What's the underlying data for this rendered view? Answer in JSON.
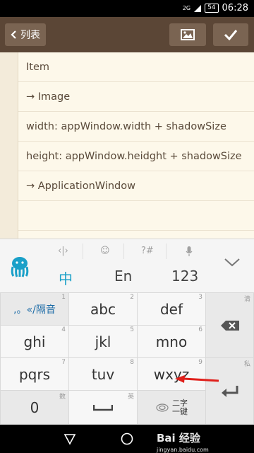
{
  "status": {
    "network": "2G",
    "battery": "54",
    "time": "06:28"
  },
  "appbar": {
    "back_label": "列表",
    "image_icon": "image-icon",
    "confirm_icon": "check-icon"
  },
  "editor": {
    "lines": [
      "Item",
      "→ Image",
      "width: appWindow.width + shadowSize",
      "height: appWindow.heidght + shadowSize",
      "→ ApplicationWindow",
      ""
    ]
  },
  "keyboard": {
    "modes": {
      "chinese": "中",
      "english": "En",
      "numbers": "123"
    },
    "keys": {
      "punct": {
        "label": ",。«/隔音",
        "num": "1"
      },
      "abc": {
        "label": "abc",
        "num": "2"
      },
      "def": {
        "label": "def",
        "num": "3"
      },
      "ghi": {
        "label": "ghi",
        "num": "4"
      },
      "jkl": {
        "label": "jkl",
        "num": "5"
      },
      "mno": {
        "label": "mno",
        "num": "6"
      },
      "pqrs": {
        "label": "pqrs",
        "num": "7"
      },
      "tuv": {
        "label": "tuv",
        "num": "8"
      },
      "wxyz": {
        "label": "wxyz",
        "num": "9"
      },
      "zero": {
        "label": "0",
        "sub": "数"
      },
      "space": {
        "sub": "英"
      },
      "twochar": {
        "label": "二字\n一键"
      },
      "clear_sub": "清",
      "private_sub": "私"
    }
  },
  "watermark": {
    "main": "Bai 经验",
    "sub": "jingyan.baidu.com"
  },
  "colors": {
    "appbar": "#5b4636",
    "editor_bg": "#fdf8ea",
    "accent": "#1aa0c8",
    "arrow": "#e0201b"
  }
}
